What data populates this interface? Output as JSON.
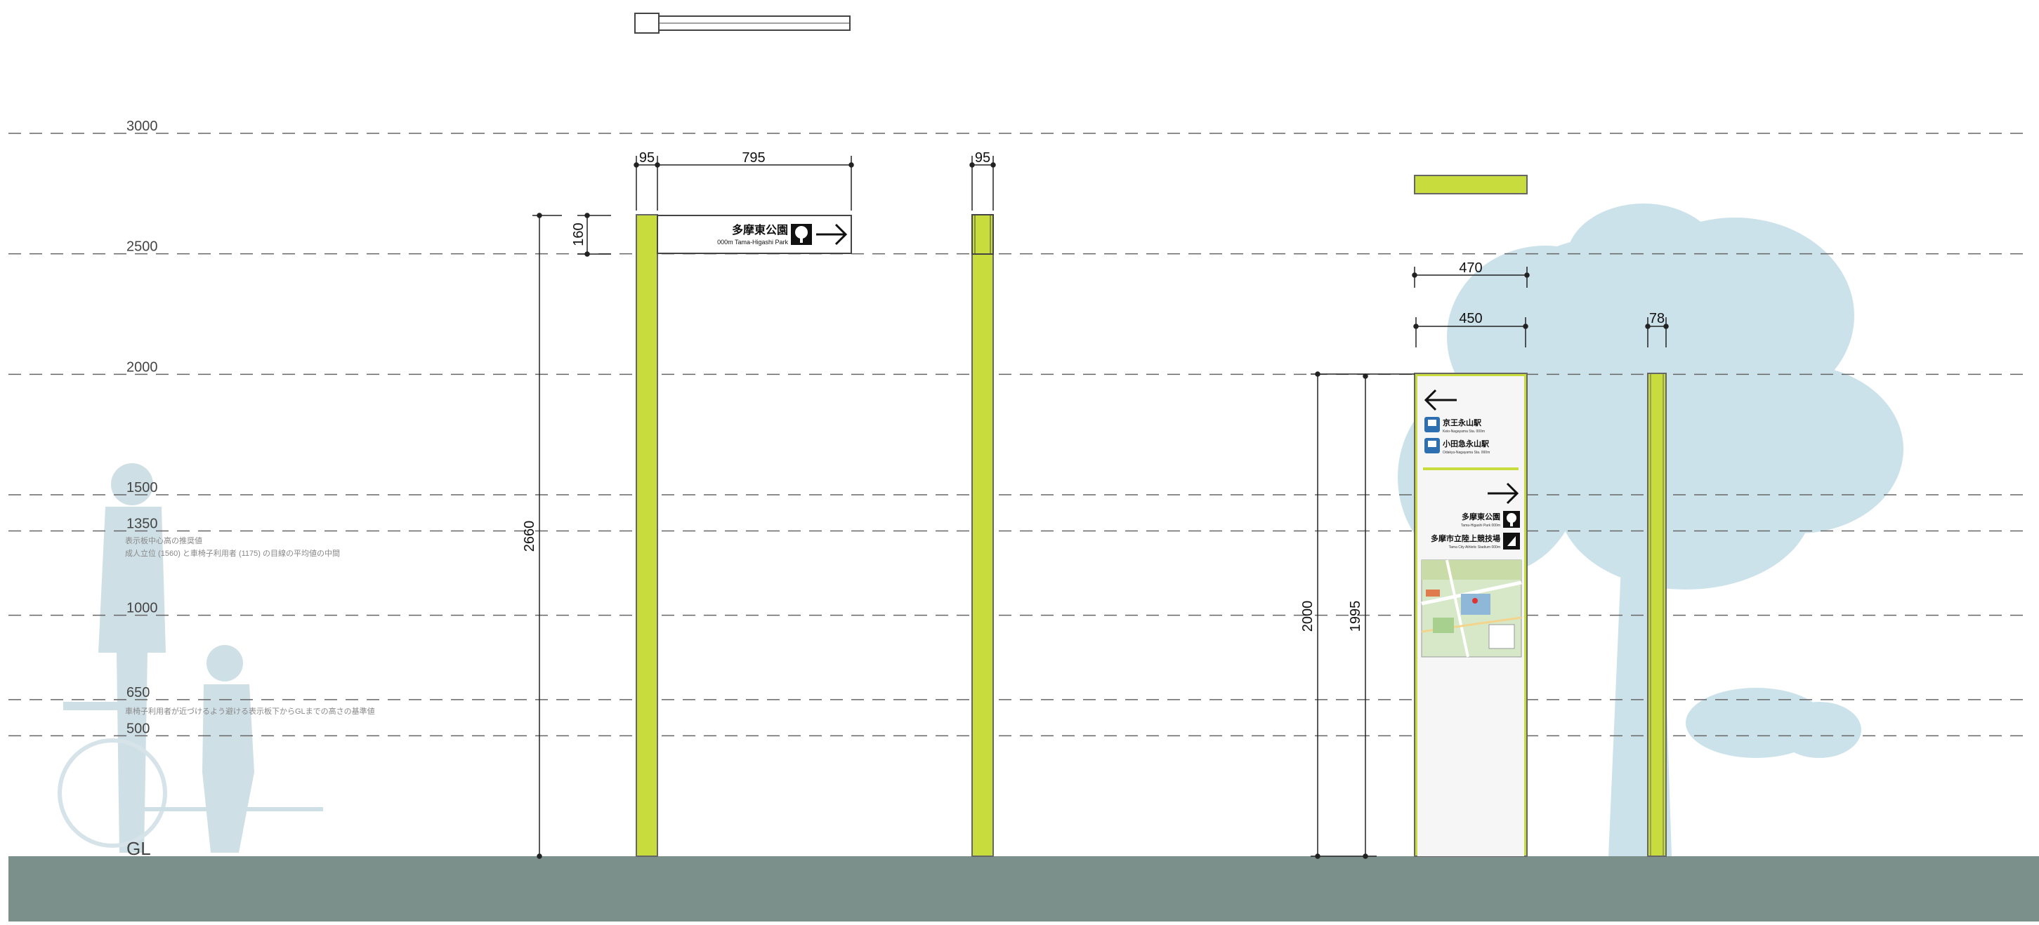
{
  "levels": [
    {
      "value": "3000",
      "mm": 3000
    },
    {
      "value": "2500",
      "mm": 2500
    },
    {
      "value": "2000",
      "mm": 2000
    },
    {
      "value": "1500",
      "mm": 1500
    },
    {
      "value": "1350",
      "mm": 1350
    },
    {
      "value": "1000",
      "mm": 1000
    },
    {
      "value": "650",
      "mm": 650
    },
    {
      "value": "500",
      "mm": 500
    }
  ],
  "ground_label": "GL",
  "notes": {
    "n1350_line1": "表示板中心高の推奨値",
    "n1350_line2": "成人立位 (1560) と車椅子利用者 (1175) の目線の平均値の中間",
    "n650": "車椅子利用者が近づけるよう避ける表示板下からGLまでの高さの基準値"
  },
  "dims": {
    "post_w": "95",
    "arm_len": "795",
    "sign_h": "160",
    "total_h": "2660",
    "post_side_w": "95",
    "panel_w": "470",
    "panel_inner_w": "450",
    "post_thin_w": "78",
    "panel_h": "2000",
    "panel_h2": "1995"
  },
  "arm_sign": {
    "title": "多摩東公園",
    "subtitle": "000m Tama-Higashi Park"
  },
  "panel": {
    "st1": "京王永山駅",
    "st1_sub": "Keio-Nagayama Sta. 000m",
    "st2": "小田急永山駅",
    "st2_sub": "Odakyu-Nagayama Sta. 000m",
    "park": "多摩東公園",
    "park_sub": "Tama-Higashi Park 000m",
    "stadium": "多摩市立陸上競技場",
    "stadium_sub": "Tama City Athletic Stadium 000m"
  },
  "colors": {
    "accent": "#c9dc3e",
    "ground": "#7b8f8b",
    "dim": "#222222",
    "tree": "#c7dfe9",
    "person": "#cfdfe6",
    "station": "#2e6fb1"
  },
  "icons": {
    "arrow_left": "arrow-left-icon",
    "arrow_right": "arrow-right-icon",
    "train": "train-icon",
    "park": "park-icon",
    "stadium": "stadium-icon",
    "map": "map-icon"
  }
}
